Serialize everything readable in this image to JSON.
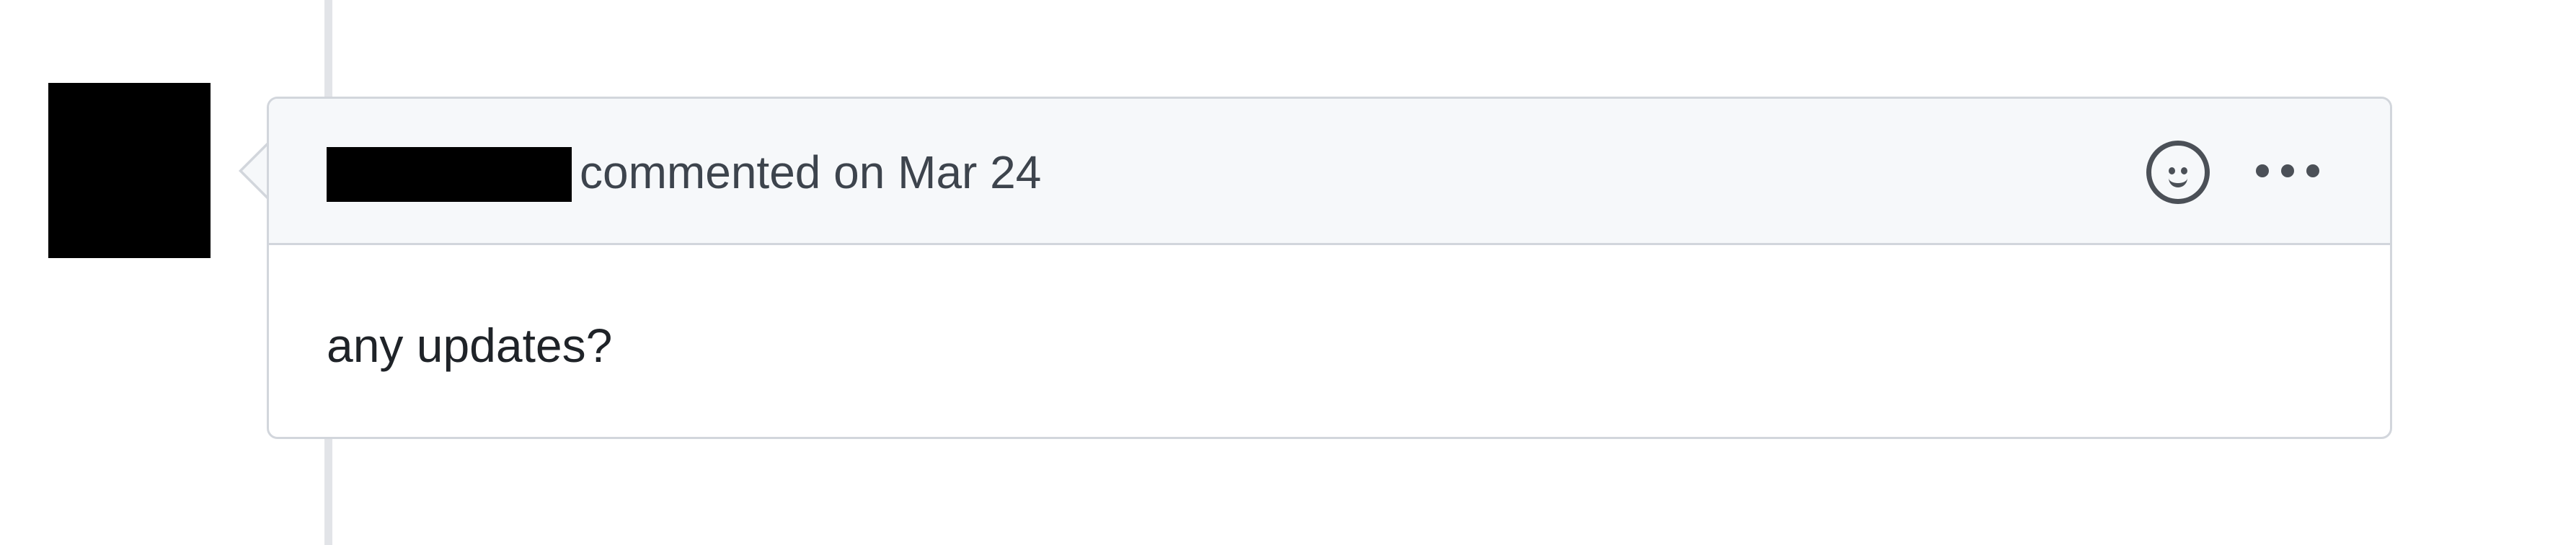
{
  "comment": {
    "meta": "commented on Mar 24",
    "body": "any updates?"
  },
  "icons": {
    "reaction": "smiley-icon",
    "more_options": "kebab-horizontal-icon"
  },
  "colors": {
    "header_background": "#f6f8fa",
    "border": "#d2d6dc",
    "icon": "#4b5057",
    "text": "#1f2328"
  }
}
